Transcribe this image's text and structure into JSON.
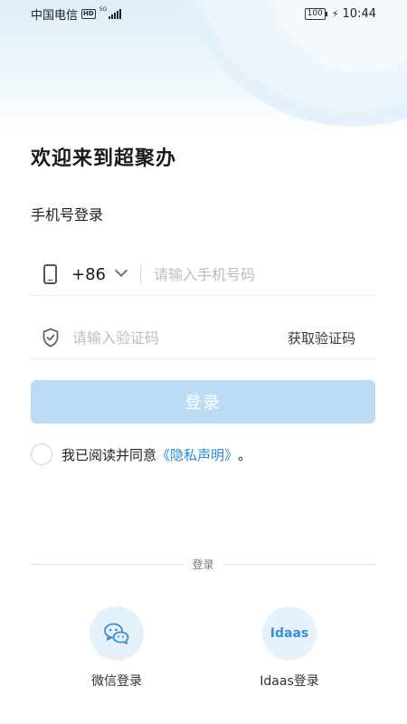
{
  "status_bar": {
    "carrier": "中国电信",
    "hd": "HD",
    "network": "5G",
    "battery": "100",
    "time": "10:44"
  },
  "page": {
    "title": "欢迎来到超聚办",
    "subtitle": "手机号登录"
  },
  "phone": {
    "country_code": "+86",
    "placeholder": "请输入手机号码",
    "value": ""
  },
  "code": {
    "placeholder": "请输入验证码",
    "value": "",
    "get_code_label": "获取验证码"
  },
  "login_button": {
    "label": "登录",
    "disabled": true
  },
  "agreement": {
    "checked": false,
    "text": "我已阅读并同意",
    "link": "《隐私声明》",
    "suffix": "。"
  },
  "other_login": {
    "divider_label": "登录",
    "options": [
      {
        "label": "微信登录",
        "icon": "wechat-icon"
      },
      {
        "label": "Idaas登录",
        "icon_text": "Idaas",
        "icon": "idaas-icon"
      }
    ]
  },
  "colors": {
    "primary_link": "#2b8ad8",
    "button_disabled": "#bcdcf6",
    "social_bg": "#e6f2fb"
  }
}
